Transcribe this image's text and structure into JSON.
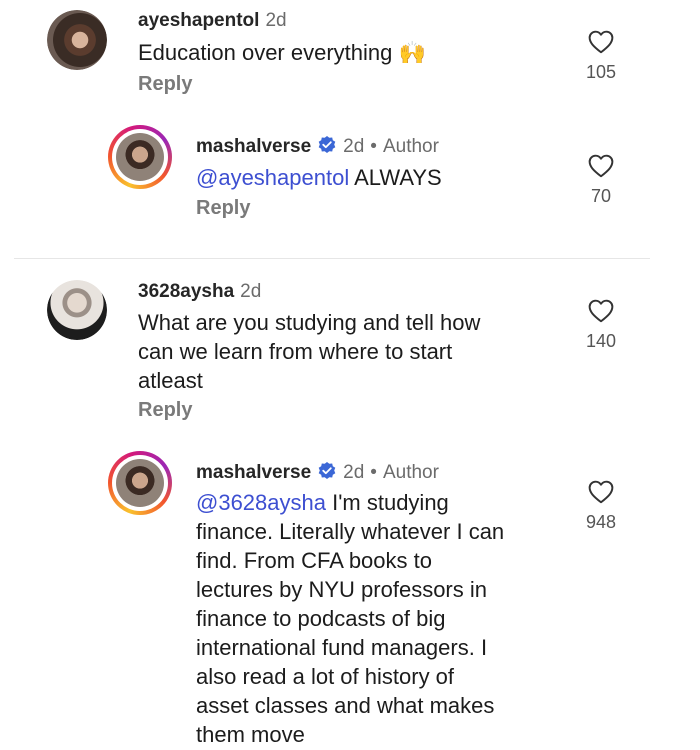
{
  "comments": [
    {
      "username": "ayeshapentol",
      "time": "2d",
      "text": "Education over everything",
      "emoji": "🙌",
      "reply": "Reply",
      "likes": "105"
    },
    {
      "username": "mashalverse",
      "time": "2d",
      "badge": "Author",
      "mention": "@ayeshapentol",
      "text": " ALWAYS",
      "reply": "Reply",
      "likes": "70"
    },
    {
      "username": "3628aysha",
      "time": "2d",
      "lines": [
        "What are you studying and tell how",
        "can we learn from where to start",
        "atleast"
      ],
      "reply": "Reply",
      "likes": "140"
    },
    {
      "username": "mashalverse",
      "time": "2d",
      "badge": "Author",
      "mention": "@3628aysha",
      "lines": [
        " I'm studying",
        "finance. Literally whatever I can",
        "find. From CFA books to",
        "lectures by NYU professors in",
        "finance to podcasts of big",
        "international fund managers. I",
        "also read a lot of history of",
        "asset classes and what makes",
        "them move"
      ],
      "likes": "948"
    }
  ],
  "colors": {
    "mention": "#3d4fd1",
    "verified": "#3b67d6"
  },
  "icons": [
    "heart-icon",
    "verified-badge-icon",
    "avatar"
  ]
}
